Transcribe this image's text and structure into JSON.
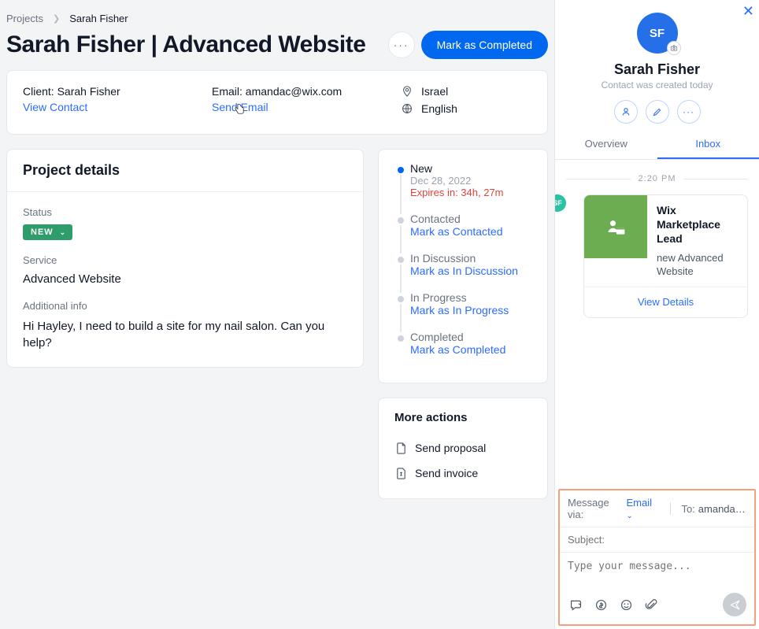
{
  "breadcrumb": {
    "root": "Projects",
    "current": "Sarah Fisher"
  },
  "title": "Sarah Fisher | Advanced Website",
  "primary_button": "Mark as Completed",
  "contact": {
    "client_label": "Client:",
    "client_name": "Sarah Fisher",
    "view_contact": "View Contact",
    "email_label": "Email:",
    "email": "amandac@wix.com",
    "send_email": "Send Email",
    "country": "Israel",
    "language": "English"
  },
  "details": {
    "heading": "Project details",
    "status_label": "Status",
    "status_badge": "NEW",
    "service_label": "Service",
    "service_value": "Advanced Website",
    "info_label": "Additional info",
    "info_value": "Hi Hayley, I need to build a site for my nail salon. Can you help?"
  },
  "timeline": [
    {
      "title": "New",
      "sub": "Dec 28, 2022",
      "red": "Expires in: 34h, 27m",
      "active": true
    },
    {
      "title": "Contacted",
      "link": "Mark as Contacted"
    },
    {
      "title": "In Discussion",
      "link": "Mark as In Discussion"
    },
    {
      "title": "In Progress",
      "link": "Mark as In Progress"
    },
    {
      "title": "Completed",
      "link": "Mark as Completed"
    }
  ],
  "more_actions": {
    "heading": "More actions",
    "proposal": "Send proposal",
    "invoice": "Send invoice"
  },
  "side": {
    "initials": "SF",
    "name": "Sarah Fisher",
    "sub": "Contact was created today",
    "tabs": {
      "overview": "Overview",
      "inbox": "Inbox"
    },
    "time": "2:20 PM",
    "card": {
      "title": "Wix Marketplace Lead",
      "sub": "new Advanced Website",
      "cta": "View Details"
    },
    "mini_av": "SF"
  },
  "composer": {
    "via_label": "Message via:",
    "via_value": "Email",
    "to_label": "To:",
    "to_value": "amandac…",
    "subject_placeholder": "Subject:",
    "body_placeholder": "Type your message..."
  }
}
